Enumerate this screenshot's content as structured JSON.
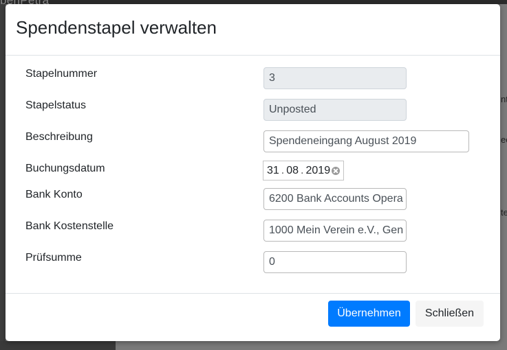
{
  "background": {
    "brand": "penPetra",
    "peek_1": "nt",
    "peek_2": "ec",
    "peek_3": "te"
  },
  "modal": {
    "title": "Spendenstapel verwalten",
    "fields": {
      "batch_number": {
        "label": "Stapelnummer",
        "value": "3"
      },
      "batch_status": {
        "label": "Stapelstatus",
        "value": "Unposted"
      },
      "description": {
        "label": "Beschreibung",
        "value": "Spendeneingang August 2019"
      },
      "posting_date": {
        "label": "Buchungsdatum",
        "day": "31",
        "month": "08",
        "year": "2019",
        "separator": "."
      },
      "bank_account": {
        "label": "Bank Konto",
        "value": "6200 Bank Accounts Opera"
      },
      "bank_cost_centre": {
        "label": "Bank Kostenstelle",
        "value": "1000 Mein Verein e.V., Gen"
      },
      "checksum": {
        "label": "Prüfsumme",
        "value": "0"
      }
    },
    "buttons": {
      "apply": "Übernehmen",
      "close": "Schließen"
    }
  },
  "colors": {
    "primary": "#007bff",
    "readonly_bg": "#e9ecef",
    "backdrop": "#6b6b6b"
  }
}
